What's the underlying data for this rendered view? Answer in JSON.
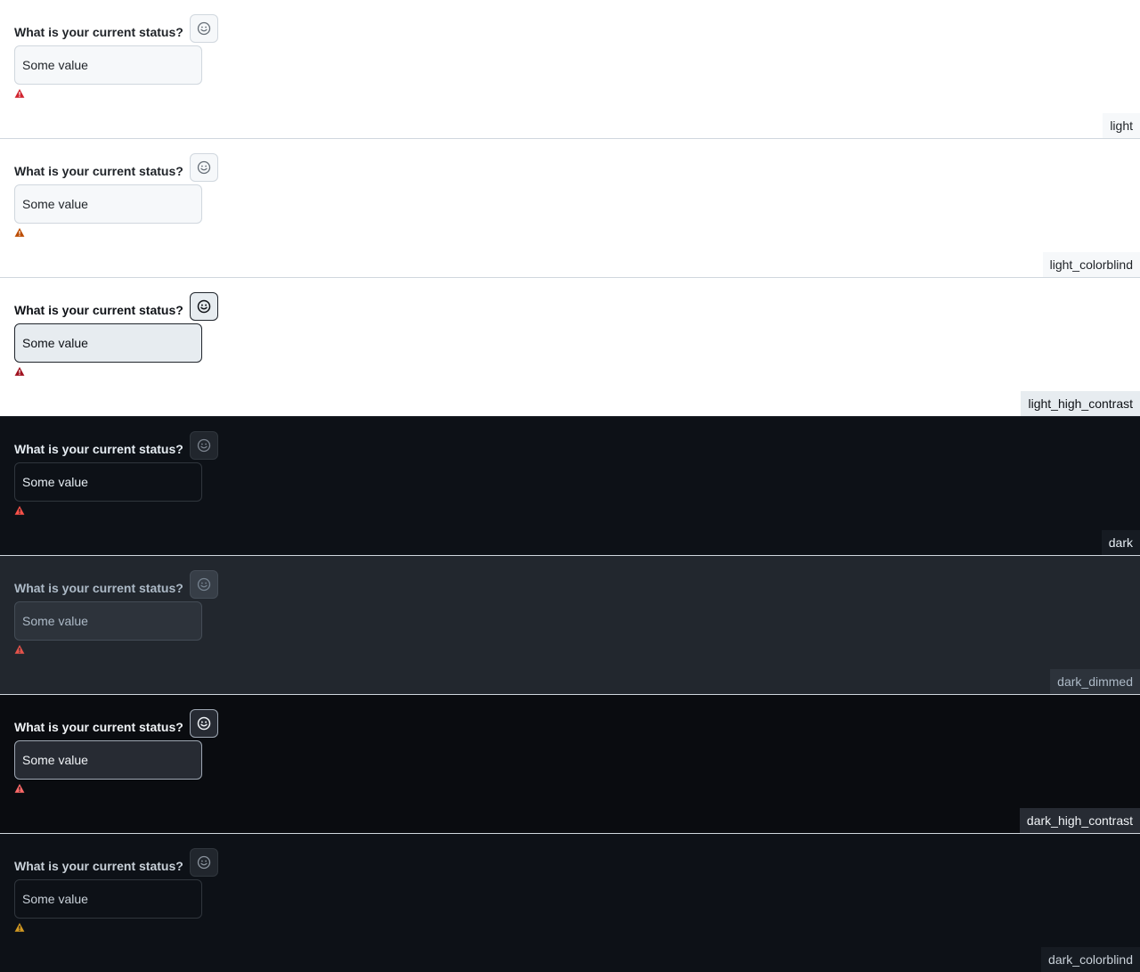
{
  "form": {
    "label": "What is your current status?",
    "input_value": "Some value",
    "emoji_button_icon": "smiley-icon",
    "validation_icon": "alert-icon"
  },
  "themes": [
    {
      "name": "light",
      "validation_color": "#d1242f"
    },
    {
      "name": "light_colorblind",
      "validation_color": "#bc4c00"
    },
    {
      "name": "light_high_contrast",
      "validation_color": "#a0111f"
    },
    {
      "name": "dark",
      "validation_color": "#f85149"
    },
    {
      "name": "dark_dimmed",
      "validation_color": "#e5534b"
    },
    {
      "name": "dark_high_contrast",
      "validation_color": "#ff6a69"
    },
    {
      "name": "dark_colorblind",
      "validation_color": "#d29922"
    }
  ]
}
